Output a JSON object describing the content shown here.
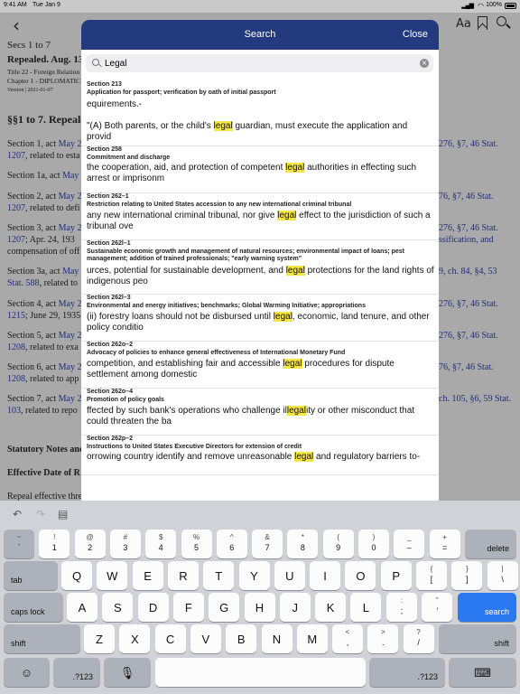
{
  "status_bar": {
    "time": "9:41 AM",
    "date": "Tue Jan 9",
    "battery": "100%",
    "icons": [
      "signal-icon",
      "wifi-icon",
      "battery-icon"
    ]
  },
  "document": {
    "title": "Secs 1 to 7",
    "subtitle": "Repealed. Aug. 13",
    "breadcrumb1": "Title 22 - Foreign Relation",
    "breadcrumb2": "Chapter 1 - DIPLOMATIC",
    "version": "Version | 2021-01-07",
    "heading": "§§1 to 7. Repeale",
    "lines": [
      {
        "a": "Section 1, act ",
        "b": "May 2",
        "right": "276, §7, 46 Stat."
      },
      {
        "a": "1207",
        "b": ", related to esta",
        "right": ""
      },
      {
        "a": "Section 1a, act ",
        "b": "May",
        "right": ""
      },
      {
        "a": "Section 2, act ",
        "b": "May 2",
        "right": "76, §7, 46 Stat."
      },
      {
        "a": "1207",
        "b": ", related to defi",
        "right": ""
      },
      {
        "a": "Section 3, act ",
        "b": "May 2",
        "right": "276, §7, 46 Stat."
      },
      {
        "a": "1207",
        "b": "; Apr. 24, 193",
        "right": "ssification, and"
      },
      {
        "a": "compensation of off",
        "b": "",
        "right": ""
      },
      {
        "a": "Section 3a, act ",
        "b": "May",
        "right": "9, ch. 84, §4, 53"
      },
      {
        "a": "Stat. 588",
        "b": ", related to",
        "right": ""
      },
      {
        "a": "Section 4, act ",
        "b": "May 2",
        "right": "276, §7, 46 Stat."
      },
      {
        "a": "1215",
        "b": "; June 29, 1935",
        "right": ""
      },
      {
        "a": "Section 5, act ",
        "b": "May 2",
        "right": "276, §7, 46 Stat."
      },
      {
        "a": "1208",
        "b": ", related to exa",
        "right": ""
      },
      {
        "a": "Section 6, act ",
        "b": "May 2",
        "right": "76, §7, 46 Stat."
      },
      {
        "a": "1208",
        "b": ", related to app",
        "right": ""
      },
      {
        "a": "Section 7, act ",
        "b": "May 2",
        "right": "ch. 105, §6, 59 Stat."
      },
      {
        "a": "103",
        "b": ", related to repo",
        "right": ""
      }
    ],
    "notes_heading": "Statutory Notes and",
    "effective_heading": "Effective Date of R",
    "repeal_text": "Repeal effective thre"
  },
  "panel": {
    "title": "Search",
    "done_label": "Close",
    "search_value": "Legal",
    "search_placeholder": "Search",
    "results": [
      {
        "section": "Section 213",
        "heading": "Application for passport; verification by oath of initial passport",
        "snippet_pre": "equirements.-\n\n\"(A) Both parents, or the child's ",
        "snippet_hl": "legal",
        "snippet_post": " guardian, must execute the application and provid"
      },
      {
        "section": "Section 258",
        "heading": "Commitment and discharge",
        "snippet_pre": "the cooperation, aid, and protection of competent ",
        "snippet_hl": "legal",
        "snippet_post": " authorities in effecting such arrest or imprisonm"
      },
      {
        "section": "Section 262–1",
        "heading": "Restriction relating to United States accession to any new international criminal tribunal",
        "snippet_pre": "any new international criminal tribunal, nor give ",
        "snippet_hl": "legal",
        "snippet_post": " effect to the jurisdiction of such a tribunal ove"
      },
      {
        "section": "Section 262l–1",
        "heading": "Sustainable economic growth and management of natural resources; environmental impact of loans; pest management; addition of trained professionals; \"early warning system\"",
        "snippet_pre": "urces, potential for sustainable development, and ",
        "snippet_hl": "legal",
        "snippet_post": " protections for the land rights of indigenous peo"
      },
      {
        "section": "Section 262l–3",
        "heading": "Environmental and energy initiatives; benchmarks; Global Warming Initiative; appropriations",
        "snippet_pre": "(ii) forestry loans should not be disbursed until ",
        "snippet_hl": "legal",
        "snippet_post": ", economic, land tenure, and other policy conditio"
      },
      {
        "section": "Section 262o–2",
        "heading": "Advocacy of policies to enhance general effectiveness of International Monetary Fund",
        "snippet_pre": "competition, and establishing fair and accessible ",
        "snippet_hl": "legal",
        "snippet_post": " procedures for dispute settlement among domestic"
      },
      {
        "section": "Section 262o–4",
        "heading": "Promotion of policy goals",
        "snippet_pre": "ffected by such bank's operations who challenge il",
        "snippet_hl": "legal",
        "snippet_post": "ity or other misconduct that could threaten the ba"
      },
      {
        "section": "Section 262p–2",
        "heading": "Instructions to United States Executive Directors for extension of credit",
        "snippet_pre": "orrowing country identify and remove unreasonable ",
        "snippet_hl": "legal",
        "snippet_post": " and regulatory barriers to-"
      }
    ]
  },
  "keyboard": {
    "tools": [
      "undo-icon",
      "redo-icon",
      "paste-icon"
    ],
    "row1": [
      {
        "top": "~",
        "bot": "`"
      },
      {
        "top": "!",
        "bot": "1"
      },
      {
        "top": "@",
        "bot": "2"
      },
      {
        "top": "#",
        "bot": "3"
      },
      {
        "top": "$",
        "bot": "4"
      },
      {
        "top": "%",
        "bot": "5"
      },
      {
        "top": "^",
        "bot": "6"
      },
      {
        "top": "&",
        "bot": "7"
      },
      {
        "top": "*",
        "bot": "8"
      },
      {
        "top": "(",
        "bot": "9"
      },
      {
        "top": ")",
        "bot": "0"
      },
      {
        "top": "_",
        "bot": "–"
      },
      {
        "top": "+",
        "bot": "="
      }
    ],
    "delete": "delete",
    "tab": "tab",
    "row2": [
      "Q",
      "W",
      "E",
      "R",
      "T",
      "Y",
      "U",
      "I",
      "O",
      "P"
    ],
    "row2_sym": [
      {
        "top": "{",
        "bot": "["
      },
      {
        "top": "}",
        "bot": "]"
      },
      {
        "top": "|",
        "bot": "\\"
      }
    ],
    "caps": "caps lock",
    "row3": [
      "A",
      "S",
      "D",
      "F",
      "G",
      "H",
      "J",
      "K",
      "L"
    ],
    "row3_sym": [
      {
        "top": ":",
        "bot": ";"
      },
      {
        "top": "”",
        "bot": "'"
      }
    ],
    "search": "search",
    "shift": "shift",
    "row4": [
      "Z",
      "X",
      "C",
      "V",
      "B",
      "N",
      "M"
    ],
    "row4_sym": [
      {
        "top": "<",
        "bot": ","
      },
      {
        "top": ">",
        "bot": "."
      },
      {
        "top": "?",
        "bot": "/"
      }
    ],
    "num_left": ".?123",
    "num_right": ".?123"
  }
}
